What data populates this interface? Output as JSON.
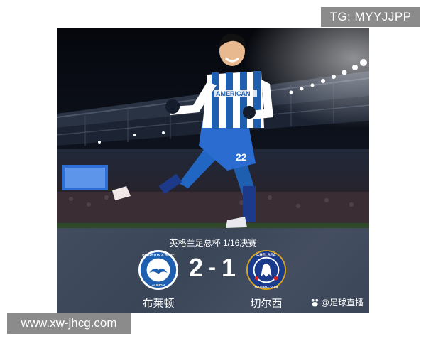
{
  "watermark_top": "TG: MYYJJPP",
  "watermark_bottom": "www.xw-jhcg.com",
  "photo": {
    "jersey_text": "AMERICAN",
    "jersey_number": "22"
  },
  "scoreboard": {
    "competition": "英格兰足总杯 1/16决赛",
    "home": {
      "name": "布莱顿",
      "crest_text_top": "BRIGHTON & HOVE",
      "crest_text_bottom": "ALBION",
      "score": "2",
      "crest_color": "#1f5fb0"
    },
    "away": {
      "name": "切尔西",
      "crest_text_top": "CHELSEA",
      "crest_text_bottom": "FOOTBALL CLUB",
      "score": "1",
      "crest_color": "#1a3a8c"
    },
    "separator": "-",
    "source": "@足球直播"
  }
}
